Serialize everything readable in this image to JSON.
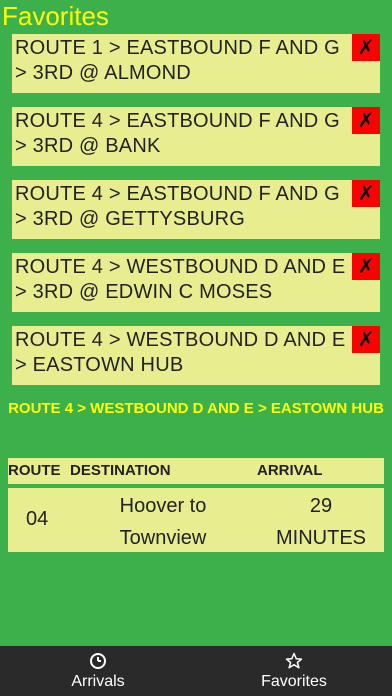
{
  "header": {
    "title": "Favorites"
  },
  "favorites": [
    {
      "label": "ROUTE 1 > EASTBOUND F AND G > 3RD @ ALMOND",
      "delete": "✗"
    },
    {
      "label": "ROUTE 4 > EASTBOUND F AND G > 3RD @ BANK",
      "delete": "✗"
    },
    {
      "label": "ROUTE 4 > EASTBOUND F AND G > 3RD @ GETTYSBURG",
      "delete": "✗"
    },
    {
      "label": "ROUTE 4 > WESTBOUND D AND E > 3RD @ EDWIN C MOSES",
      "delete": "✗"
    },
    {
      "label": "ROUTE 4 > WESTBOUND D AND E > EASTOWN HUB",
      "delete": "✗"
    }
  ],
  "selected": {
    "text": "ROUTE 4 > WESTBOUND D AND E > EASTOWN HUB"
  },
  "table": {
    "headers": {
      "route": "ROUTE",
      "destination": "DESTINATION",
      "arrival": "ARRIVAL"
    },
    "rows": [
      {
        "route": "04",
        "destination": "Hoover to Townview",
        "arrival": "29 MINUTES"
      }
    ]
  },
  "tabs": [
    {
      "label": "Arrivals",
      "icon": "clock-icon"
    },
    {
      "label": "Favorites",
      "icon": "star-icon"
    }
  ],
  "colors": {
    "background": "#3cb04a",
    "accent": "#ffff00",
    "card": "#e8ee8f",
    "delete": "#ff0000",
    "tabbar": "#2a2a2a"
  }
}
